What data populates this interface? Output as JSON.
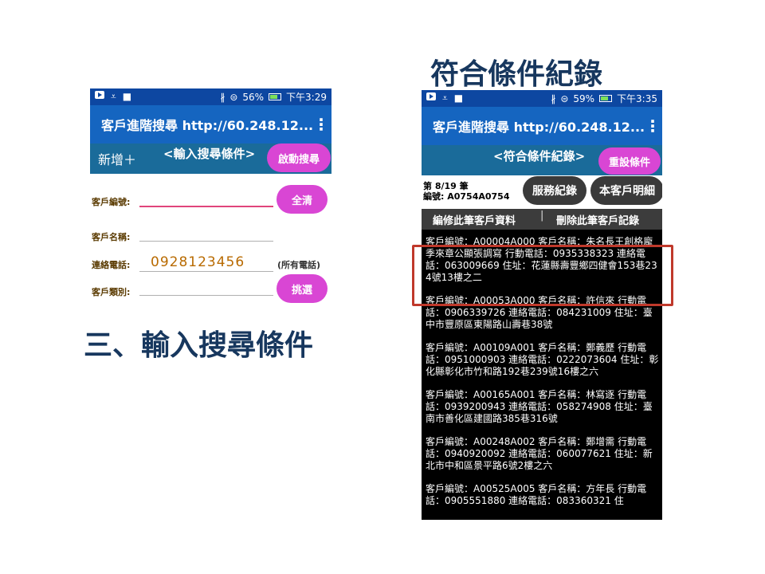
{
  "slide": {
    "title_right": "符合條件紀錄",
    "title_left": "三、輸入搜尋條件"
  },
  "left_phone": {
    "status": {
      "icons_left": [
        "youtube-icon",
        "download-check-icon",
        "puzzle-icon"
      ],
      "bluetooth": "∦",
      "wifi": "⊜",
      "battery_pct": "56%",
      "time": "下午3:29"
    },
    "appbar": {
      "title": "客戶進階搜尋  http://60.248.12...",
      "menu": "⋮"
    },
    "subbar": {
      "add": "新增＋",
      "title": "<輸入搜尋條件>",
      "search_btn": "啟動搜尋"
    },
    "form": {
      "customer_no_label": "客戶編號:",
      "clear_btn": "全清",
      "customer_name_label": "客戶名稱:",
      "phone_label": "連絡電話:",
      "phone_value": "0928123456",
      "phone_hint": "(所有電話)",
      "type_label": "客戶類別:",
      "select_btn": "挑選"
    }
  },
  "right_phone": {
    "status": {
      "bluetooth": "∦",
      "wifi": "⊜",
      "battery_pct": "59%",
      "time": "下午3:35"
    },
    "appbar": {
      "title": "客戶進階搜尋  http://60.248.12...",
      "menu": "⋮"
    },
    "subbar": {
      "title": "<符合條件紀錄>",
      "reset_btn": "重設條件"
    },
    "record": {
      "position": "第  8/19  筆",
      "number": "編號:  A0754A0754",
      "service_btn": "服務紀錄",
      "detail_btn": "本客戶明細"
    },
    "actions": {
      "edit": "編修此筆客戶資料",
      "divider": "|",
      "delete": "刪除此筆客戶記錄"
    },
    "results": [
      "客戶編號：A00004A000  客戶名稱：朱名長王創格龐季來章公顯張調寫  行動電話：0935338323  連絡電話：063009669  住址：花蓮縣壽豐鄉四健會153巷234號13樓之二",
      "客戶編號：A00053A000  客戶名稱：許信來  行動電話：0906339726  連絡電話：084231009  住址：臺中市豐原區東陽路山壽巷38號",
      "客戶編號：A00109A001  客戶名稱：鄭義歷  行動電話：0951000903  連絡電話：0222073604  住址：彰化縣彰化市竹和路192巷239號16樓之六",
      "客戶編號：A00165A001  客戶名稱：林寫逐  行動電話：0939200943  連絡電話：058274908  住址：臺南市善化區建國路385巷316號",
      "客戶編號：A00248A002  客戶名稱：鄭增需  行動電話：0940920092  連絡電話：060077621  住址：新北市中和區景平路6號2樓之六",
      "客戶編號：A00525A005  客戶名稱：方年長  行動電話：0905551880  連絡電話：083360321  住"
    ]
  },
  "colors": {
    "status_bar": "#0d47a1",
    "app_bar": "#1565c0",
    "sub_bar": "#1a6b9a",
    "accent_pill": "#d946d4",
    "highlight": "#c0392b",
    "title": "#17375e"
  }
}
